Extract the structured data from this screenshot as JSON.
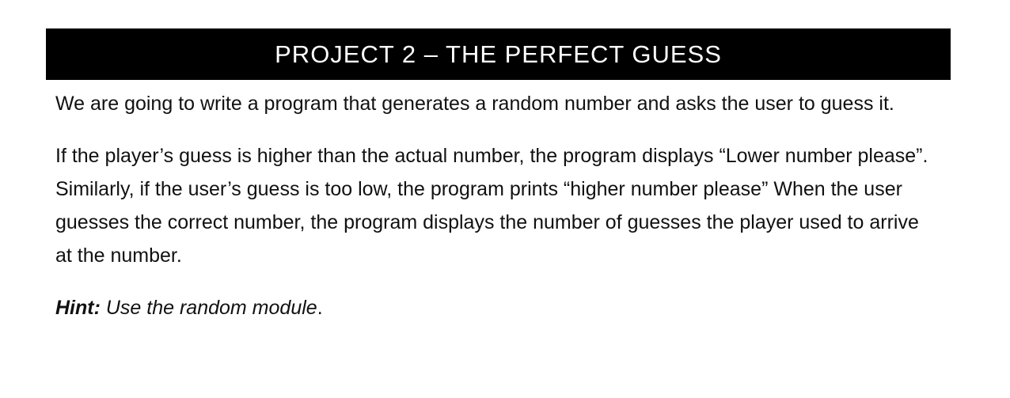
{
  "header": {
    "title": "PROJECT 2 – THE PERFECT GUESS"
  },
  "body": {
    "paragraph_1": "We are going to write a program that generates a random number and asks the user to guess it.",
    "paragraph_2": "If the player’s guess is higher than the actual number, the program displays “Lower number please”. Similarly, if the user’s guess is too low, the program prints “higher number please” When the user guesses the correct number, the program displays the number of guesses the player used to arrive at the number.",
    "hint_label": "Hint:",
    "hint_text": " Use the random module",
    "hint_end": "."
  },
  "colors": {
    "title_bar_bg": "#000000",
    "title_text": "#ffffff",
    "body_text": "#111111"
  }
}
